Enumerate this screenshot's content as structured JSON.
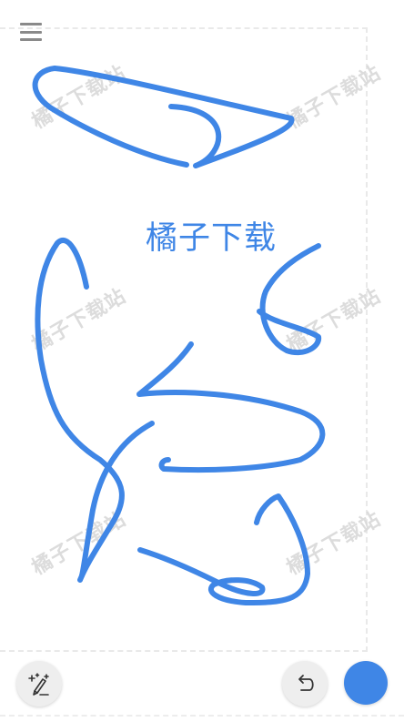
{
  "toolbar": {
    "menu_icon": "hamburger-menu-icon",
    "magic_icon": "magic-pen-icon",
    "undo_icon": "undo-icon",
    "color_swatch": "#3f86e6"
  },
  "canvas": {
    "stroke_color": "#3f86e6",
    "center_text": "橘子下载",
    "watermark_text": "橘子下载站"
  },
  "colors": {
    "stroke": "#3f86e6",
    "button_bg": "#eeeeee",
    "watermark": "#d9d9d9"
  }
}
